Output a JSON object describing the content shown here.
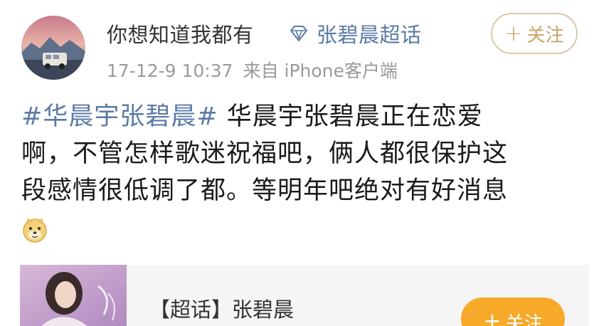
{
  "header": {
    "username": "你想知道我都有",
    "supertopic_label": "张碧晨超话",
    "timestamp": "17-12-9 10:37",
    "source": "来自 iPhone客户端",
    "follow_label": "关注",
    "follow_plus": "+"
  },
  "post": {
    "hashtag": "#华晨宇张碧晨#",
    "line1_text": " 华晨宇张碧晨正在恋爱",
    "line2": "啊，不管怎样歌迷祝福吧，俩人都很保护这",
    "line3": "段感情很低调了都。等明年吧绝对有好消息",
    "emoji": "doge-emoji"
  },
  "card": {
    "title": "【超话】张碧晨",
    "follow_label": "关注",
    "follow_plus": "+"
  },
  "colors": {
    "link_blue": "#5b7aa6",
    "follow_gold": "#c9a46a",
    "follow_orange": "#f7a92a",
    "meta_gray": "#9a9a9a"
  }
}
